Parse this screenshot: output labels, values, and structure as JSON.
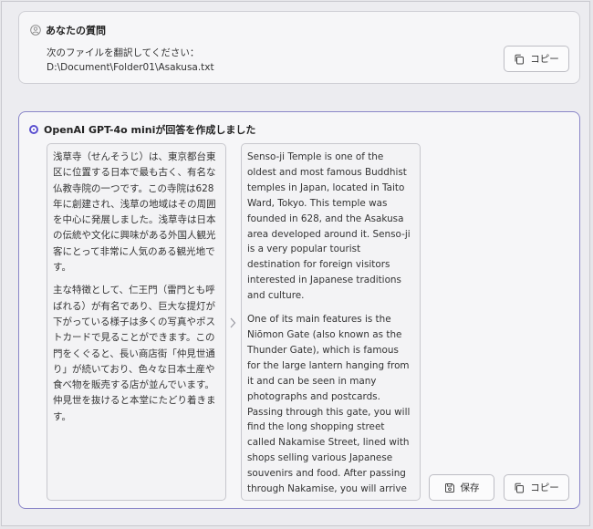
{
  "question": {
    "title": "あなたの質問",
    "line1": "次のファイルを翻訳してください：",
    "line2": "D:\\Document\\Folder01\\Asakusa.txt",
    "copy_label": "コピー"
  },
  "answer": {
    "title": "OpenAI GPT-4o miniが回答を作成しました",
    "source_paragraphs": [
      "浅草寺（せんそうじ）は、東京都台東区に位置する日本で最も古く、有名な仏教寺院の一つです。この寺院は628年に創建され、浅草の地域はその周囲を中心に発展しました。浅草寺は日本の伝統や文化に興味がある外国人観光客にとって非常に人気のある観光地です。",
      "主な特徴として、仁王門（雷門とも呼ばれる）が有名であり、巨大な提灯が下がっている様子は多くの写真やポストカードで見ることができます。この門をくぐると、長い商店街「仲見世通り」が続いており、色々な日本土産や食べ物を販売する店が並んでいます。仲見世を抜けると本堂にたどり着きます。"
    ],
    "translation_paragraphs": [
      "Senso-ji Temple is one of the oldest and most famous Buddhist temples in Japan, located in Taito Ward, Tokyo. This temple was founded in 628, and the Asakusa area developed around it. Senso-ji is a very popular tourist destination for foreign visitors interested in Japanese traditions and culture.",
      "One of its main features is the Niōmon Gate (also known as the Thunder Gate), which is famous for the large lantern hanging from it and can be seen in many photographs and postcards. Passing through this gate, you will find the long shopping street called Nakamise Street, lined with shops selling various Japanese souvenirs and food. After passing through Nakamise, you will arrive at the main hall."
    ],
    "save_label": "保存",
    "copy_label": "コピー"
  },
  "colors": {
    "accent": "#5a4fcf",
    "card_border_active": "#8a86c8"
  },
  "icons": [
    "user-icon",
    "copy-icon",
    "radio-selected-icon",
    "chevron-right-icon",
    "save-icon"
  ]
}
